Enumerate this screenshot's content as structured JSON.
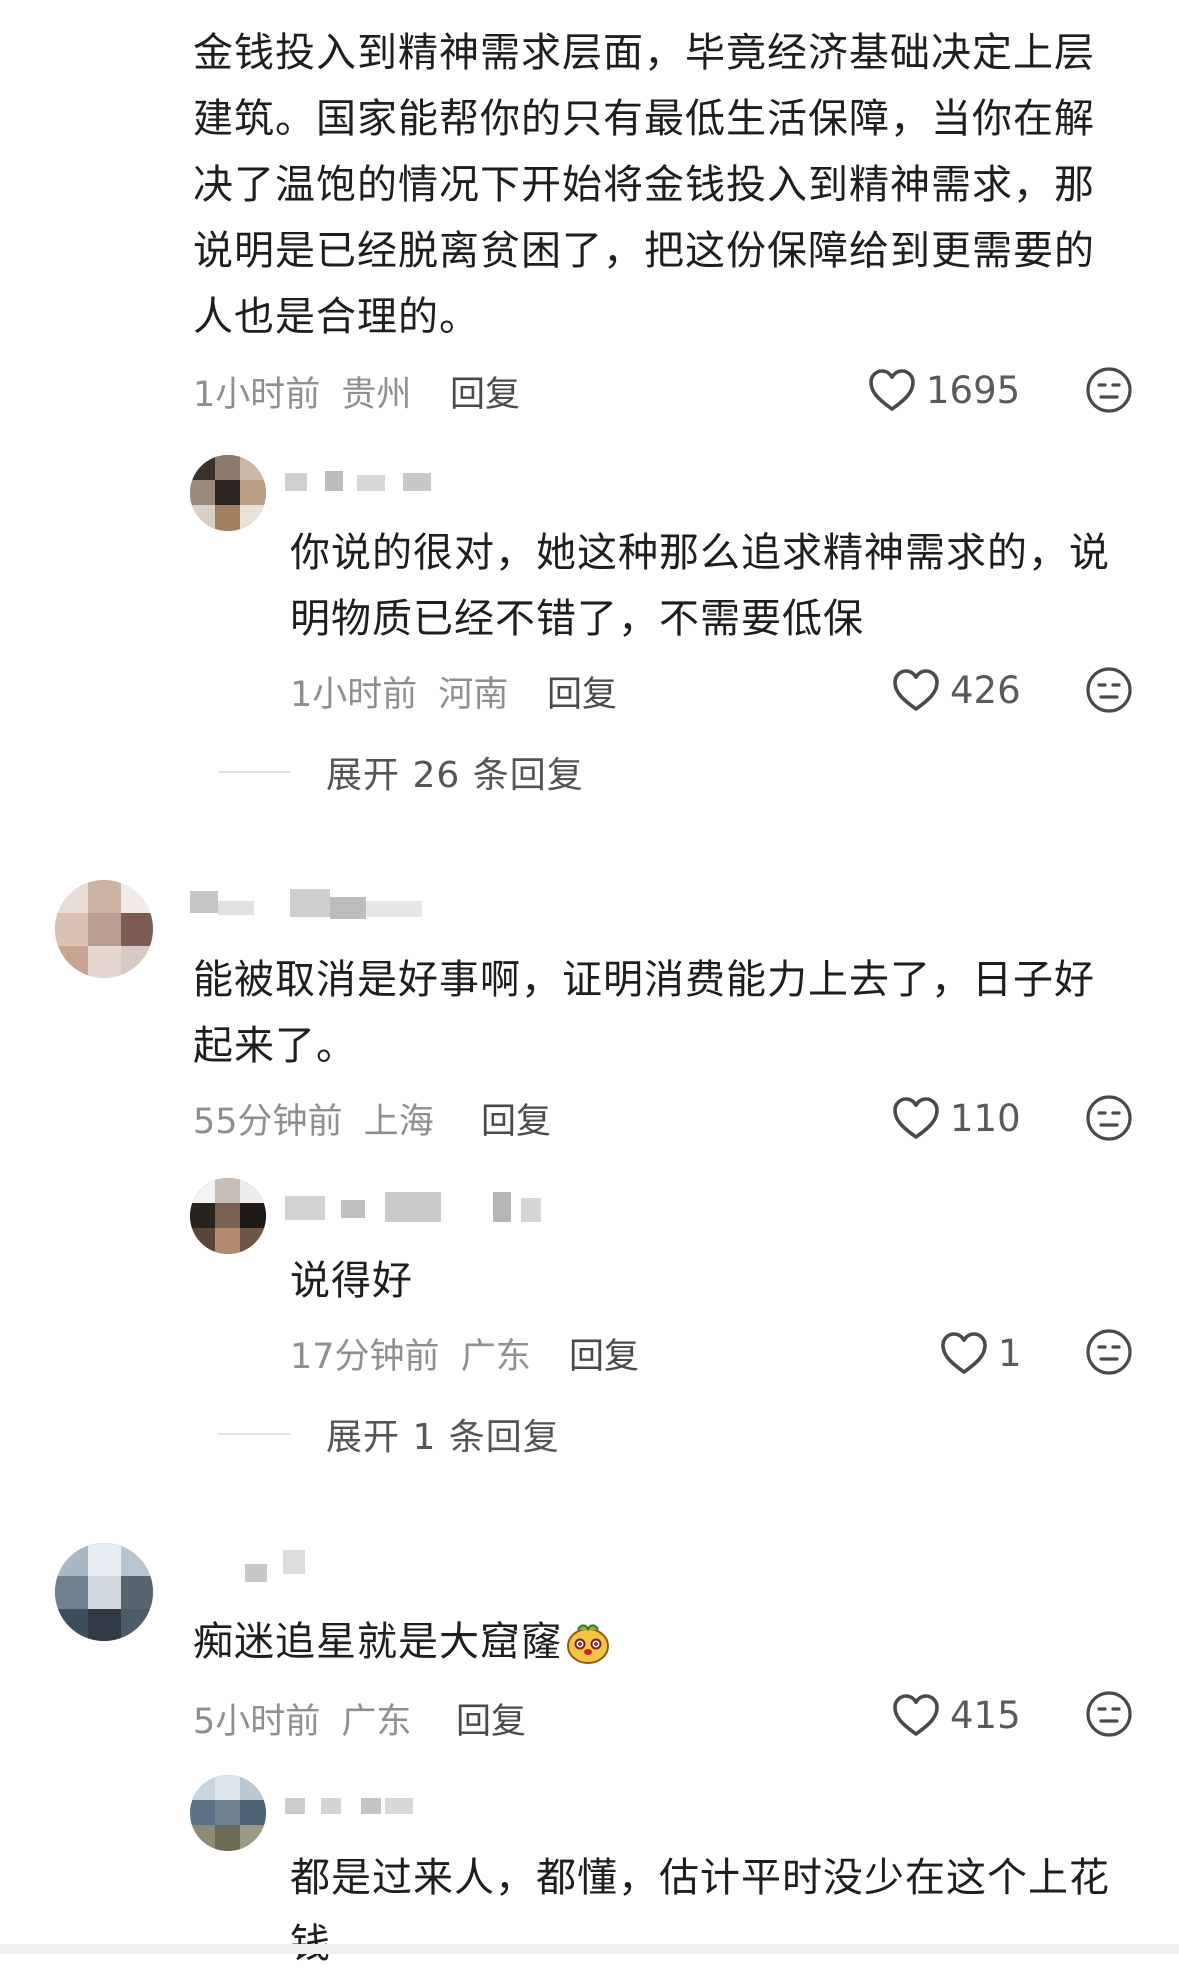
{
  "comments": [
    {
      "text_lines": [
        "金钱投入到精神需求层面，毕竟经济基础决定上层",
        "建筑。国家能帮你的只有最低生活保障，当你在解",
        "决了温饱的情况下开始将金钱投入到精神需求，那",
        "说明是已经脱离贫困了，把这份保障给到更需要的",
        "人也是合理的。"
      ],
      "time": "1小时前",
      "location": "贵州",
      "reply_label": "回复",
      "likes": "1695"
    },
    {
      "text_lines": [
        "你说的很对，她这种那么追求精神需求的，说",
        "明物质已经不错了，不需要低保"
      ],
      "time": "1小时前",
      "location": "河南",
      "reply_label": "回复",
      "likes": "426",
      "expand_label": "展开 26 条回复"
    },
    {
      "text_lines": [
        "能被取消是好事啊，证明消费能力上去了，日子好",
        "起来了。"
      ],
      "time": "55分钟前",
      "location": "上海",
      "reply_label": "回复",
      "likes": "110"
    },
    {
      "text_lines": [
        "说得好"
      ],
      "time": "17分钟前",
      "location": "广东",
      "reply_label": "回复",
      "likes": "1",
      "expand_label": "展开 1 条回复"
    },
    {
      "text_lines": [
        "痴迷追星就是大窟窿"
      ],
      "time": "5小时前",
      "location": "广东",
      "reply_label": "回复",
      "likes": "415"
    },
    {
      "text_lines": [
        "都是过来人，都懂，估计平时没少在这个上花",
        "钱"
      ]
    }
  ],
  "icons": {
    "like": "heart-outline-icon",
    "emoji": "neutral-face-icon",
    "inline_emoji": "cute-dog-emoji"
  },
  "colors": {
    "text": "#1e1e1e",
    "meta": "#8f8f8f",
    "icon": "#4a4a4a"
  }
}
